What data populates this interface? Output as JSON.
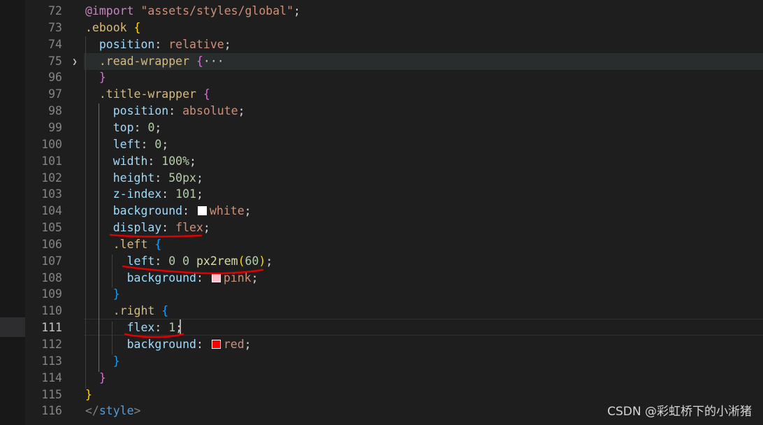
{
  "editor": {
    "colors": {
      "background": "#1e1e1e",
      "white_swatch": "#ffffff",
      "pink_swatch": "#ffc0cb",
      "red_swatch": "#ff0000",
      "annotation": "#e00000"
    },
    "fold_icon": "chevron-right-icon",
    "current_line": 111,
    "lines": [
      {
        "num": "72",
        "tokens": [
          [
            "kw",
            "@import"
          ],
          [
            "punc",
            " "
          ],
          [
            "str",
            "\"assets/styles/global\""
          ],
          [
            "punc",
            ";"
          ]
        ]
      },
      {
        "num": "73",
        "tokens": [
          [
            "sel",
            ".ebook"
          ],
          [
            "punc",
            " "
          ],
          [
            "b1",
            "{"
          ]
        ]
      },
      {
        "num": "74",
        "tokens": [
          [
            "punc",
            "  "
          ],
          [
            "prop",
            "position"
          ],
          [
            "punc",
            ": "
          ],
          [
            "val",
            "relative"
          ],
          [
            "punc",
            ";"
          ]
        ]
      },
      {
        "num": "75",
        "tokens": [
          [
            "punc",
            "  "
          ],
          [
            "sel",
            ".read-wrapper"
          ],
          [
            "punc",
            " "
          ],
          [
            "b2",
            "{"
          ],
          [
            "ell",
            "···"
          ]
        ]
      },
      {
        "num": "96",
        "tokens": [
          [
            "punc",
            "  "
          ],
          [
            "b2",
            "}"
          ]
        ]
      },
      {
        "num": "97",
        "tokens": [
          [
            "punc",
            "  "
          ],
          [
            "sel",
            ".title-wrapper"
          ],
          [
            "punc",
            " "
          ],
          [
            "b2",
            "{"
          ]
        ]
      },
      {
        "num": "98",
        "tokens": [
          [
            "punc",
            "    "
          ],
          [
            "prop",
            "position"
          ],
          [
            "punc",
            ": "
          ],
          [
            "val",
            "absolute"
          ],
          [
            "punc",
            ";"
          ]
        ]
      },
      {
        "num": "99",
        "tokens": [
          [
            "punc",
            "    "
          ],
          [
            "prop",
            "top"
          ],
          [
            "punc",
            ": "
          ],
          [
            "num",
            "0"
          ],
          [
            "punc",
            ";"
          ]
        ]
      },
      {
        "num": "100",
        "tokens": [
          [
            "punc",
            "    "
          ],
          [
            "prop",
            "left"
          ],
          [
            "punc",
            ": "
          ],
          [
            "num",
            "0"
          ],
          [
            "punc",
            ";"
          ]
        ]
      },
      {
        "num": "101",
        "tokens": [
          [
            "punc",
            "    "
          ],
          [
            "prop",
            "width"
          ],
          [
            "punc",
            ": "
          ],
          [
            "num",
            "100%"
          ],
          [
            "punc",
            ";"
          ]
        ]
      },
      {
        "num": "102",
        "tokens": [
          [
            "punc",
            "    "
          ],
          [
            "prop",
            "height"
          ],
          [
            "punc",
            ": "
          ],
          [
            "num",
            "50px"
          ],
          [
            "punc",
            ";"
          ]
        ]
      },
      {
        "num": "103",
        "tokens": [
          [
            "punc",
            "    "
          ],
          [
            "prop",
            "z-index"
          ],
          [
            "punc",
            ": "
          ],
          [
            "num",
            "101"
          ],
          [
            "punc",
            ";"
          ]
        ]
      },
      {
        "num": "104",
        "tokens": [
          [
            "punc",
            "    "
          ],
          [
            "prop",
            "background"
          ],
          [
            "punc",
            ": "
          ],
          [
            "swatch",
            "#ffffff"
          ],
          [
            "val",
            "white"
          ],
          [
            "punc",
            ";"
          ]
        ]
      },
      {
        "num": "105",
        "tokens": [
          [
            "punc",
            "    "
          ],
          [
            "prop",
            "display"
          ],
          [
            "punc",
            ": "
          ],
          [
            "val",
            "flex"
          ],
          [
            "punc",
            ";"
          ]
        ]
      },
      {
        "num": "106",
        "tokens": [
          [
            "punc",
            "    "
          ],
          [
            "sel",
            ".left"
          ],
          [
            "punc",
            " "
          ],
          [
            "b3",
            "{"
          ]
        ]
      },
      {
        "num": "107",
        "tokens": [
          [
            "punc",
            "      "
          ],
          [
            "prop",
            "left"
          ],
          [
            "punc",
            ": "
          ],
          [
            "num",
            "0"
          ],
          [
            "punc",
            " "
          ],
          [
            "num",
            "0"
          ],
          [
            "punc",
            " "
          ],
          [
            "fn",
            "px2rem"
          ],
          [
            "b1",
            "("
          ],
          [
            "num",
            "60"
          ],
          [
            "b1",
            ")"
          ],
          [
            "punc",
            ";"
          ]
        ]
      },
      {
        "num": "108",
        "tokens": [
          [
            "punc",
            "      "
          ],
          [
            "prop",
            "background"
          ],
          [
            "punc",
            ": "
          ],
          [
            "swatch",
            "#ffc0cb"
          ],
          [
            "val",
            "pink"
          ],
          [
            "punc",
            ";"
          ]
        ]
      },
      {
        "num": "109",
        "tokens": [
          [
            "punc",
            "    "
          ],
          [
            "b3",
            "}"
          ]
        ]
      },
      {
        "num": "110",
        "tokens": [
          [
            "punc",
            "    "
          ],
          [
            "sel",
            ".right"
          ],
          [
            "punc",
            " "
          ],
          [
            "b3",
            "{"
          ]
        ]
      },
      {
        "num": "111",
        "tokens": [
          [
            "punc",
            "      "
          ],
          [
            "prop",
            "flex"
          ],
          [
            "punc",
            ": "
          ],
          [
            "num",
            "1"
          ],
          [
            "punc",
            ";"
          ]
        ]
      },
      {
        "num": "112",
        "tokens": [
          [
            "punc",
            "      "
          ],
          [
            "prop",
            "background"
          ],
          [
            "punc",
            ": "
          ],
          [
            "swatch",
            "#ff0000"
          ],
          [
            "val",
            "red"
          ],
          [
            "punc",
            ";"
          ]
        ]
      },
      {
        "num": "113",
        "tokens": [
          [
            "punc",
            "    "
          ],
          [
            "b3",
            "}"
          ]
        ]
      },
      {
        "num": "114",
        "tokens": [
          [
            "punc",
            "  "
          ],
          [
            "b2",
            "}"
          ]
        ]
      },
      {
        "num": "115",
        "tokens": [
          [
            "b1",
            "}"
          ]
        ]
      },
      {
        "num": "116",
        "tokens": [
          [
            "ang",
            "</"
          ],
          [
            "tag",
            "style"
          ],
          [
            "ang",
            ">"
          ]
        ]
      }
    ]
  },
  "watermark": "CSDN @彩虹桥下的小淅猪"
}
